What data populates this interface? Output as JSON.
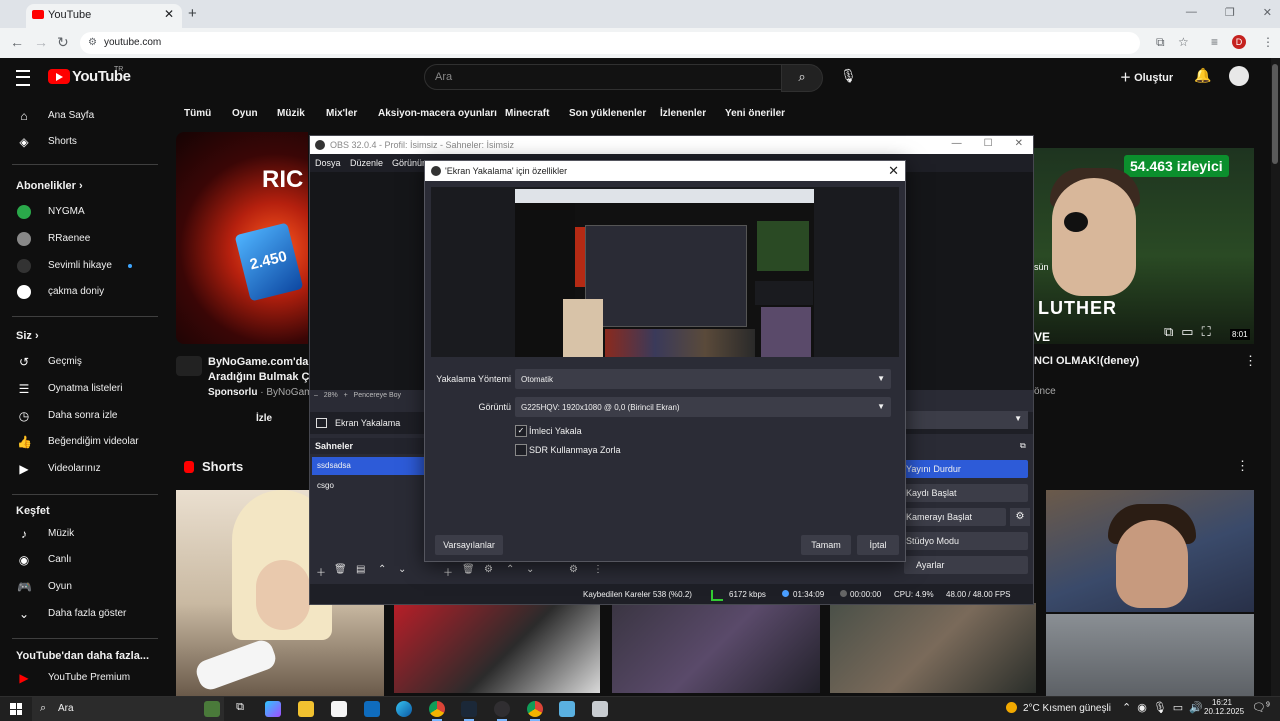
{
  "browser": {
    "tab_title": "YouTube",
    "url": "youtube.com",
    "new_tab": "+",
    "profile_letter": "D"
  },
  "youtube": {
    "logo_text": "YouTube",
    "logo_region": "TR",
    "search_placeholder": "Ara",
    "create_label": "Oluştur",
    "chips": [
      "Tümü",
      "Oyun",
      "Müzik",
      "Mix'ler",
      "Aksiyon-macera oyunları",
      "Minecraft",
      "Son yüklenenler",
      "İzlenenler",
      "Yeni öneriler"
    ],
    "sidebar": {
      "main": [
        {
          "label": "Ana Sayfa",
          "icon": "home-icon"
        },
        {
          "label": "Shorts",
          "icon": "shorts-icon"
        }
      ],
      "subs_header": "Abonelikler",
      "subs": [
        {
          "label": "NYGMA",
          "color": "#2aa84a"
        },
        {
          "label": "RRaenee",
          "color": "#888888"
        },
        {
          "label": "Sevimli hikaye",
          "color": "#333333"
        },
        {
          "label": "çakma doniy",
          "color": "#ffffff"
        }
      ],
      "you_header": "Siz",
      "you": [
        {
          "label": "Geçmiş",
          "icon": "history-icon"
        },
        {
          "label": "Oynatma listeleri",
          "icon": "playlist-icon"
        },
        {
          "label": "Daha sonra izle",
          "icon": "watch-later-icon"
        },
        {
          "label": "Beğendiğim videolar",
          "icon": "like-icon"
        },
        {
          "label": "Videolarınız",
          "icon": "your-videos-icon"
        }
      ],
      "explore_header": "Keşfet",
      "explore": [
        {
          "label": "Müzik",
          "icon": "music-icon"
        },
        {
          "label": "Canlı",
          "icon": "live-icon"
        },
        {
          "label": "Oyun",
          "icon": "game-icon"
        },
        {
          "label": "Daha fazla göster",
          "icon": "chevron-down-icon"
        }
      ],
      "more_header": "YouTube'dan daha fazla...",
      "more": [
        {
          "label": "YouTube Premium",
          "icon": "youtube-premium-icon"
        }
      ]
    },
    "ad": {
      "thumb_text": "RIC",
      "card_text": "2.450",
      "title_line1": "ByNoGame.com'da İs",
      "title_line2": "Aradığını Bulmak Çok",
      "sponsor": "Sponsorlu",
      "channel": "ByNoGamec",
      "button": "İzle"
    },
    "shorts_header": "Shorts",
    "right_video": {
      "viewers": "54.463 izleyici",
      "overlay_sun": "sün",
      "overlay_name": "LUTHER",
      "overlay_ve": "VE",
      "duration": "8:01",
      "title": "NCI OLMAK!(deney)",
      "meta": "önce"
    }
  },
  "obs": {
    "title": "OBS 32.0.4 - Profil: İsimsiz - Sahneler: İsimsiz",
    "menu": [
      "Dosya",
      "Düzenle",
      "Görünüm"
    ],
    "zoom": "28%",
    "zoom_rest": "Pencereye Boy",
    "source": "Ekran Yakalama",
    "scenes_header": "Sahneler",
    "scenes": [
      "ssdsadsa",
      "csgo"
    ],
    "controls": [
      "Yayını Durdur",
      "Kaydı Başlat",
      "Kamerayı Başlat",
      "Stüdyo Modu",
      "Ayarlar"
    ],
    "status": {
      "dropped": "Kaybedilen Kareler 538 (%0.2)",
      "bitrate": "6172 kbps",
      "live_time": "01:34:09",
      "rec_time": "00:00:00",
      "cpu": "CPU: 4.9%",
      "fps": "48.00 / 48.00 FPS"
    }
  },
  "dialog": {
    "title": "'Ekran Yakalama' için özellikler",
    "capture_method_label": "Yakalama Yöntemi",
    "capture_method_value": "Otomatik",
    "display_label": "Görüntü",
    "display_value": "G225HQV: 1920x1080 @ 0,0 (Birincil Ekran)",
    "cursor_label": "İmleci Yakala",
    "cursor_checked": true,
    "sdr_label": "SDR Kullanmaya Zorla",
    "sdr_checked": false,
    "defaults_button": "Varsayılanlar",
    "ok_button": "Tamam",
    "cancel_button": "İptal"
  },
  "taskbar": {
    "search": "Ara",
    "weather": "2°C  Kısmen güneşli",
    "time": "16:21",
    "date": "20.12.2025",
    "notifications": "9"
  }
}
